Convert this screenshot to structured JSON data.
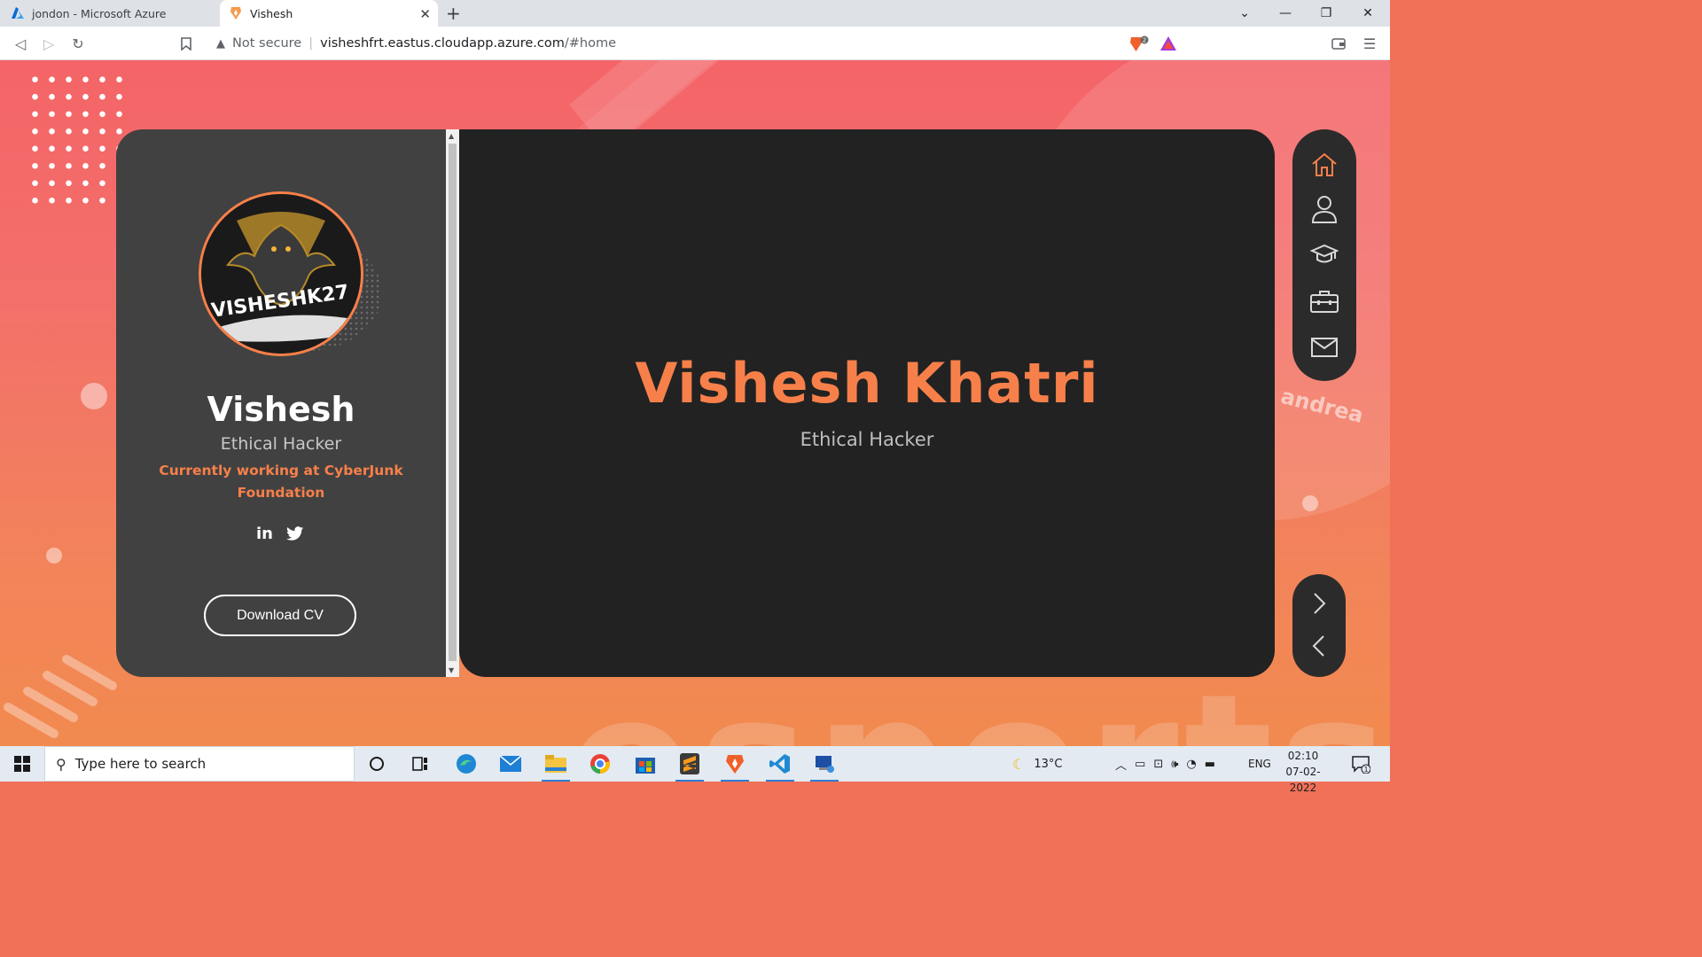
{
  "browser": {
    "tabs": [
      {
        "title": "jondon - Microsoft Azure",
        "active": false
      },
      {
        "title": "Vishesh",
        "active": true
      }
    ],
    "security_label": "Not secure",
    "url_host": "visheshfrt.eastus.cloudapp.azure.com",
    "url_path": "/#home",
    "brave_badge": "2"
  },
  "profile": {
    "avatar_text": "VISHESHK27",
    "name": "Vishesh",
    "role": "Ethical Hacker",
    "work": "Currently working at CyberJunk Foundation",
    "social": [
      {
        "icon": "linkedin-icon",
        "label": "in"
      },
      {
        "icon": "twitter-icon",
        "label": ""
      }
    ],
    "cv_button": "Download CV"
  },
  "hero": {
    "title": "Vishesh Khatri",
    "subtitle": "Ethical Hacker"
  },
  "nav": [
    {
      "icon": "home-icon",
      "active": true
    },
    {
      "icon": "user-icon",
      "active": false
    },
    {
      "icon": "graduation-cap-icon",
      "active": false
    },
    {
      "icon": "briefcase-icon",
      "active": false
    },
    {
      "icon": "mail-icon",
      "active": false
    }
  ],
  "background_text": {
    "big": "esports",
    "small": "andrea"
  },
  "colors": {
    "accent": "#f7804a",
    "card_left": "#414141",
    "card_right": "#222222"
  },
  "taskbar": {
    "search_placeholder": "Type here to search",
    "weather": "13°C",
    "language": "ENG",
    "time": "02:10",
    "date": "07-02-2022",
    "notification_count": "1",
    "apps": [
      "cortana-icon",
      "task-view-icon",
      "edge-icon",
      "mail-icon",
      "file-explorer-icon",
      "chrome-icon",
      "store-icon",
      "sublime-icon",
      "brave-icon",
      "vscode-icon",
      "remote-desktop-icon"
    ]
  }
}
